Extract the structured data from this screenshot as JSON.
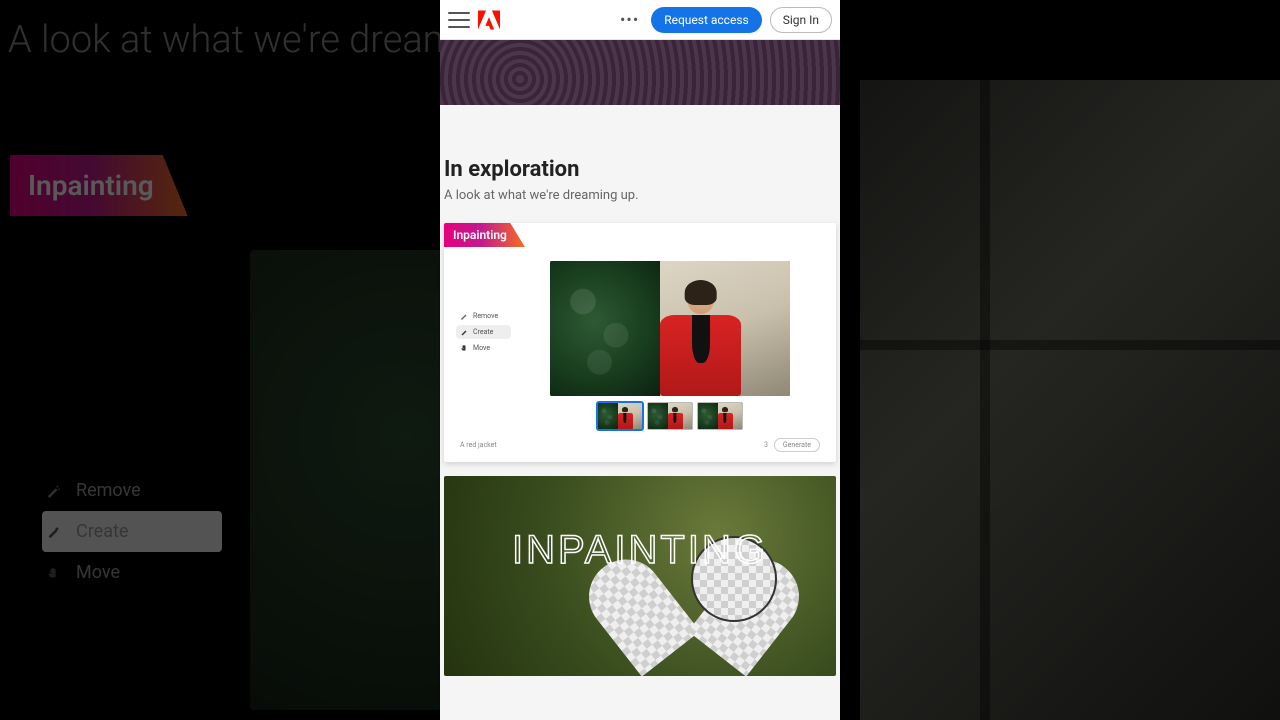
{
  "background": {
    "heading": "A look at what we're dreami",
    "feature_tag": "Inpainting",
    "tools": [
      {
        "key": "remove",
        "label": "Remove",
        "active": false
      },
      {
        "key": "create",
        "label": "Create",
        "active": true
      },
      {
        "key": "move",
        "label": "Move",
        "active": false
      }
    ]
  },
  "topbar": {
    "more_label": "•••",
    "request_access": "Request access",
    "sign_in": "Sign In"
  },
  "section": {
    "title": "In exploration",
    "subtitle": "A look at what we're dreaming up."
  },
  "card": {
    "tag": "Inpainting",
    "tools": [
      {
        "key": "remove",
        "label": "Remove",
        "active": false
      },
      {
        "key": "create",
        "label": "Create",
        "active": true
      },
      {
        "key": "move",
        "label": "Move",
        "active": false
      }
    ],
    "prompt": "A red jacket",
    "thumb_count": "3",
    "generate_label": "Generate"
  },
  "overlay_title": "INPAINTING",
  "colors": {
    "accent": "#1473e6",
    "grad_start": "#e6007e",
    "grad_end": "#f36f21"
  }
}
